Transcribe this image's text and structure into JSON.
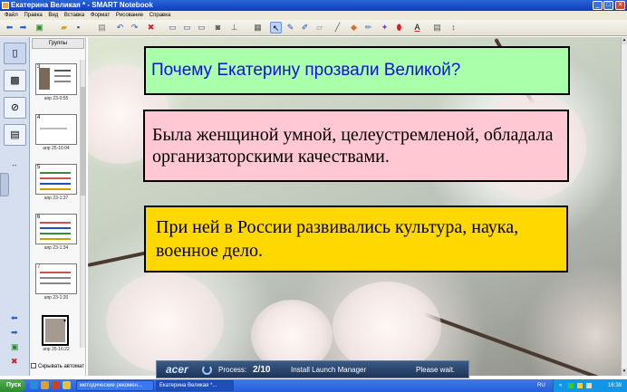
{
  "window": {
    "title": "Екатерина Великая * - SMART Notebook",
    "buttons": {
      "minimize": "_",
      "maximize": "□",
      "close": "✕"
    }
  },
  "menu": [
    "Файл",
    "Правка",
    "Вид",
    "Вставка",
    "Формат",
    "Рисование",
    "Справка"
  ],
  "toolbar": {
    "icons": [
      "back-arrow-icon",
      "forward-arrow-icon",
      "add-page-icon",
      "open-folder-icon",
      "save-icon",
      "paste-icon",
      "undo-icon",
      "redo-icon",
      "delete-icon",
      "screen-shade-icon",
      "display-icon",
      "table-icon",
      "select-arrow-icon",
      "pen-icon",
      "creative-pen-icon",
      "eraser-icon",
      "line-icon",
      "shapes-icon",
      "fill-icon",
      "magic-pen-icon",
      "text-icon",
      "properties-icon"
    ]
  },
  "sorter": {
    "groups_label": "Группы",
    "thumbnails": [
      {
        "num": "3",
        "label": "апр 23-0:55"
      },
      {
        "num": "4",
        "label": "апр 25-16:04"
      },
      {
        "num": "5",
        "label": "апр 23-1:37"
      },
      {
        "num": "6",
        "label": "апр 23-1:34"
      },
      {
        "num": "7",
        "label": "апр 23-1:20"
      },
      {
        "num": "",
        "label": "апр 25-16:22"
      }
    ],
    "autohide_label": "Скрывать автомат"
  },
  "slide": {
    "question": "Почему Екатерину прозвали Великой?",
    "answer1": "Была женщиной умной, целеустремленой, обладала организаторскими качествами.",
    "answer2": "При ней в России развивались культура, наука, военное дело.",
    "colors": {
      "question_bg": "#aaffaa",
      "question_text": "#1010e0",
      "answer1_bg": "#ffc8d2",
      "answer2_bg": "#ffd800"
    }
  },
  "acer_popup": {
    "logo": "acer",
    "process_label": "Process:",
    "process_count": "2/10",
    "message": "Install Launch Manager",
    "status": "Please wait."
  },
  "taskbar": {
    "start": "Пуск",
    "tasks": [
      "методические рекомен...",
      "Екатерина Великая *..."
    ],
    "language": "RU",
    "clock": "16:38"
  }
}
